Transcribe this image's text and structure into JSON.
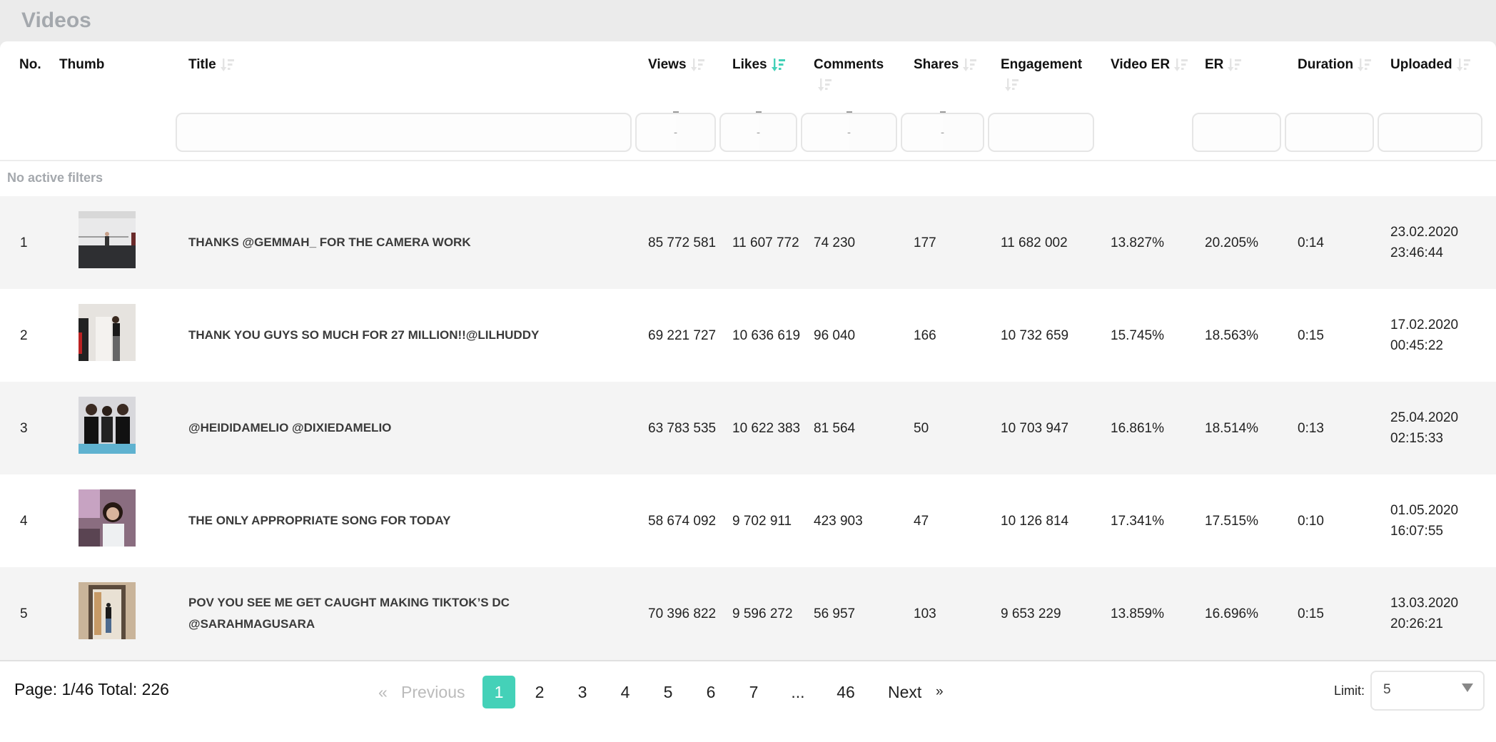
{
  "page": {
    "title": "Videos"
  },
  "colors": {
    "accent": "#44d1b8",
    "header_bg": "#ebebeb",
    "row_alt": "#f4f4f4",
    "muted_text": "#a4a8ad"
  },
  "columns": [
    {
      "key": "no",
      "label": "No.",
      "sortable": false
    },
    {
      "key": "thumb",
      "label": "Thumb",
      "sortable": false
    },
    {
      "key": "title",
      "label": "Title",
      "sortable": true,
      "sort_active": false,
      "filter": "text"
    },
    {
      "key": "views",
      "label": "Views",
      "sortable": true,
      "sort_active": false,
      "filter": "range"
    },
    {
      "key": "likes",
      "label": "Likes",
      "sortable": true,
      "sort_active": true,
      "sort_direction": "desc",
      "filter": "range"
    },
    {
      "key": "comments",
      "label": "Comments",
      "sortable": true,
      "sort_active": false,
      "filter": "range"
    },
    {
      "key": "shares",
      "label": "Shares",
      "sortable": true,
      "sort_active": false,
      "filter": "range"
    },
    {
      "key": "engagement",
      "label": "Engagement",
      "sortable": true,
      "sort_active": false,
      "filter": "text"
    },
    {
      "key": "video_er",
      "label": "Video ER",
      "sortable": true,
      "sort_active": false
    },
    {
      "key": "er",
      "label": "ER",
      "sortable": true,
      "sort_active": false,
      "filter": "text"
    },
    {
      "key": "duration",
      "label": "Duration",
      "sortable": true,
      "sort_active": false,
      "filter": "text"
    },
    {
      "key": "uploaded",
      "label": "Uploaded",
      "sortable": true,
      "sort_active": false,
      "filter": "text"
    }
  ],
  "filters": {
    "range_placeholder": "-",
    "status": "No active filters"
  },
  "rows": [
    {
      "no": "1",
      "thumb_icon": "video-thumbnail-dance-studio",
      "title": "THANKS @GEMMAH_ FOR THE CAMERA WORK",
      "views": "85 772 581",
      "likes": "11 607 772",
      "comments": "74 230",
      "shares": "177",
      "engagement": "11 682 002",
      "video_er": "13.827%",
      "er": "20.205%",
      "duration": "0:14",
      "uploaded_date": "23.02.2020",
      "uploaded_time": "23:46:44"
    },
    {
      "no": "2",
      "thumb_icon": "video-thumbnail-two-people-hallway",
      "title": "THANK YOU GUYS SO MUCH FOR 27 MILLION!!@LILHUDDY",
      "views": "69 221 727",
      "likes": "10 636 619",
      "comments": "96 040",
      "shares": "166",
      "engagement": "10 732 659",
      "video_er": "15.745%",
      "er": "18.563%",
      "duration": "0:15",
      "uploaded_date": "17.02.2020",
      "uploaded_time": "00:45:22"
    },
    {
      "no": "3",
      "thumb_icon": "video-thumbnail-three-people",
      "title": "@HEIDIDAMELIO @DIXIEDAMELIO",
      "views": "63 783 535",
      "likes": "10 622 383",
      "comments": "81 564",
      "shares": "50",
      "engagement": "10 703 947",
      "video_er": "16.861%",
      "er": "18.514%",
      "duration": "0:13",
      "uploaded_date": "25.04.2020",
      "uploaded_time": "02:15:33"
    },
    {
      "no": "4",
      "thumb_icon": "video-thumbnail-selfie-pink-room",
      "title": "THE ONLY APPROPRIATE SONG FOR TODAY",
      "views": "58 674 092",
      "likes": "9 702 911",
      "comments": "423 903",
      "shares": "47",
      "engagement": "10 126 814",
      "video_er": "17.341%",
      "er": "17.515%",
      "duration": "0:10",
      "uploaded_date": "01.05.2020",
      "uploaded_time": "16:07:55"
    },
    {
      "no": "5",
      "thumb_icon": "video-thumbnail-doorway",
      "title": "POV YOU SEE ME GET CAUGHT MAKING TIKTOK’S DC @SARAHMAGUSARA",
      "views": "70 396 822",
      "likes": "9 596 272",
      "comments": "56 957",
      "shares": "103",
      "engagement": "9 653 229",
      "video_er": "13.859%",
      "er": "16.696%",
      "duration": "0:15",
      "uploaded_date": "13.03.2020",
      "uploaded_time": "20:26:21"
    }
  ],
  "pagination": {
    "info": "Page: 1/46 Total: 226",
    "prev_arrow": "«",
    "prev_label": "Previous",
    "next_label": "Next",
    "next_arrow": "»",
    "pages": [
      "1",
      "2",
      "3",
      "4",
      "5",
      "6",
      "7",
      "...",
      "46"
    ],
    "current_page": "1",
    "limit_label": "Limit:",
    "limit_value": "5"
  }
}
